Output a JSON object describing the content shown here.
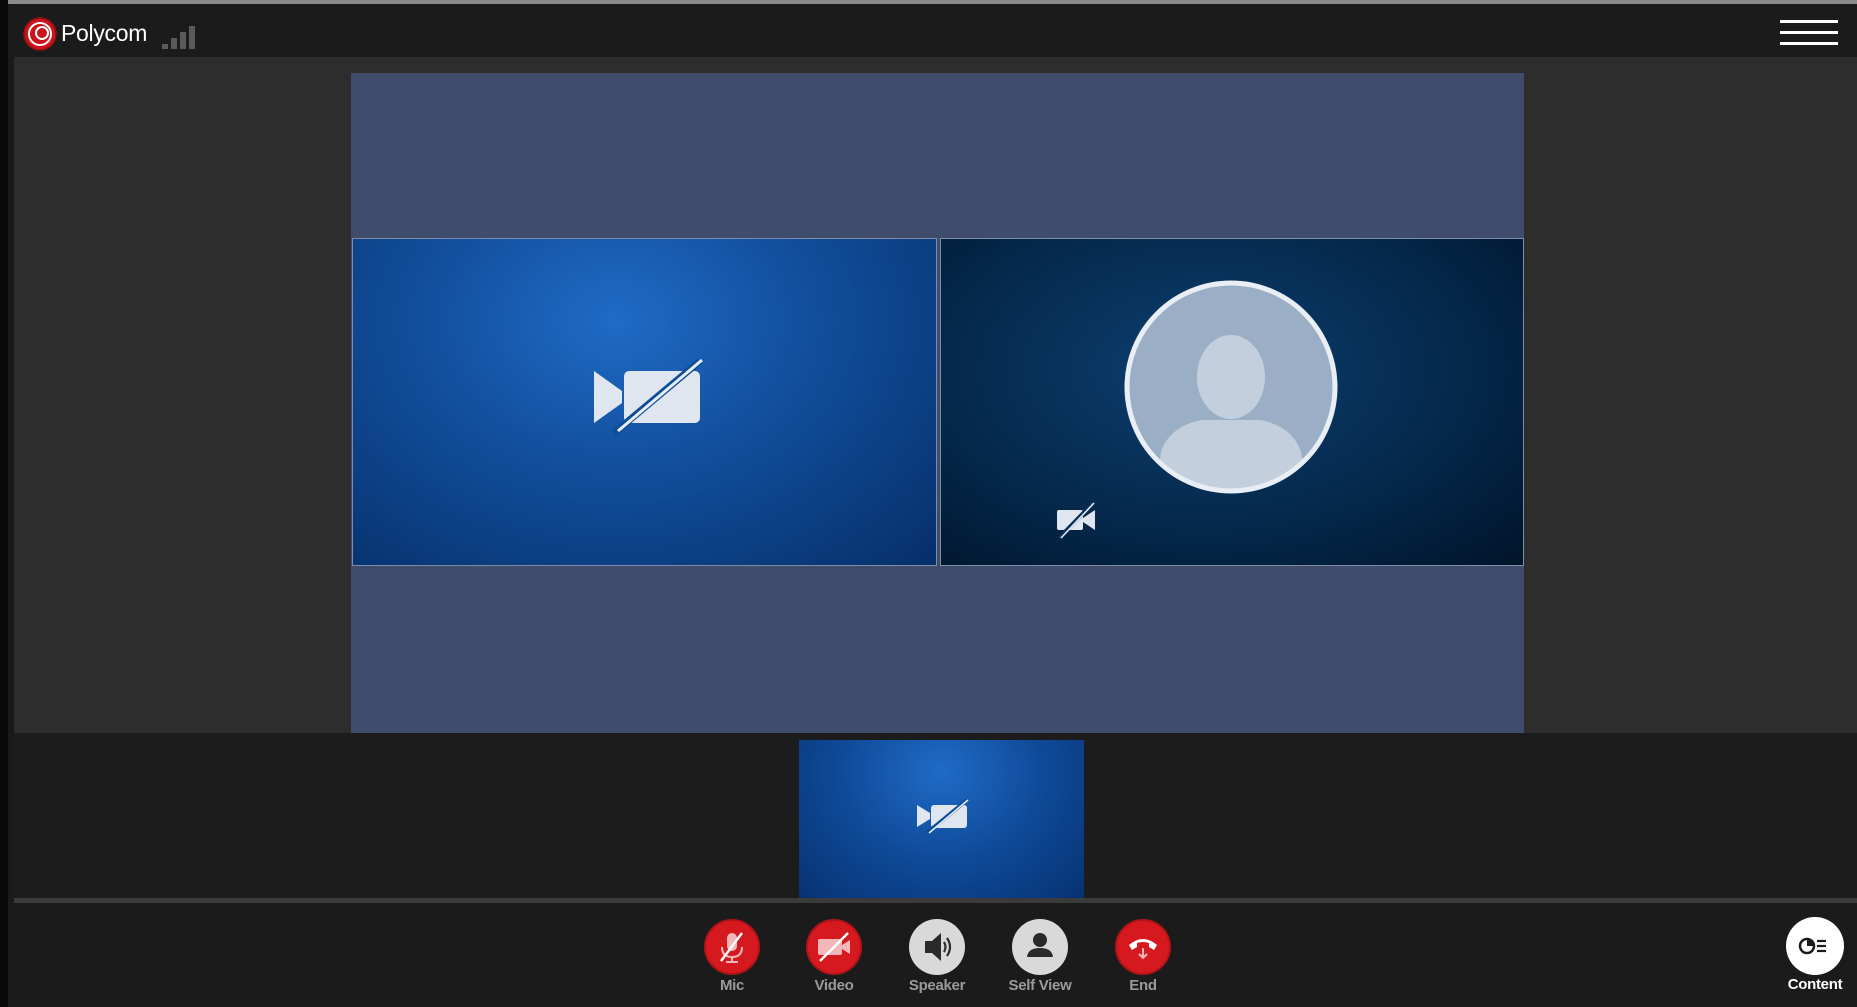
{
  "app": {
    "brand": "Polycom",
    "signal_bars": 4,
    "signal_active_bars": 0
  },
  "toolbar": {
    "mic_label": "Mic",
    "video_label": "Video",
    "speaker_label": "Speaker",
    "selfview_label": "Self View",
    "end_label": "End",
    "content_label": "Content"
  },
  "icons": {
    "menu": "hamburger-menu-icon",
    "tile_left": "camera-off-icon",
    "tile_right_avatar": "user-avatar-icon",
    "tile_right_badge": "camera-off-icon",
    "selfview": "camera-off-icon",
    "mic": "mic-muted-icon",
    "video": "video-off-icon",
    "speaker": "speaker-icon",
    "selfview_btn": "person-icon",
    "end": "hang-up-icon",
    "content": "content-share-icon"
  },
  "colors": {
    "accent_red": "#d6191f",
    "topbar": "#1b1b1b",
    "stage_bg": "#3f4c6c"
  }
}
